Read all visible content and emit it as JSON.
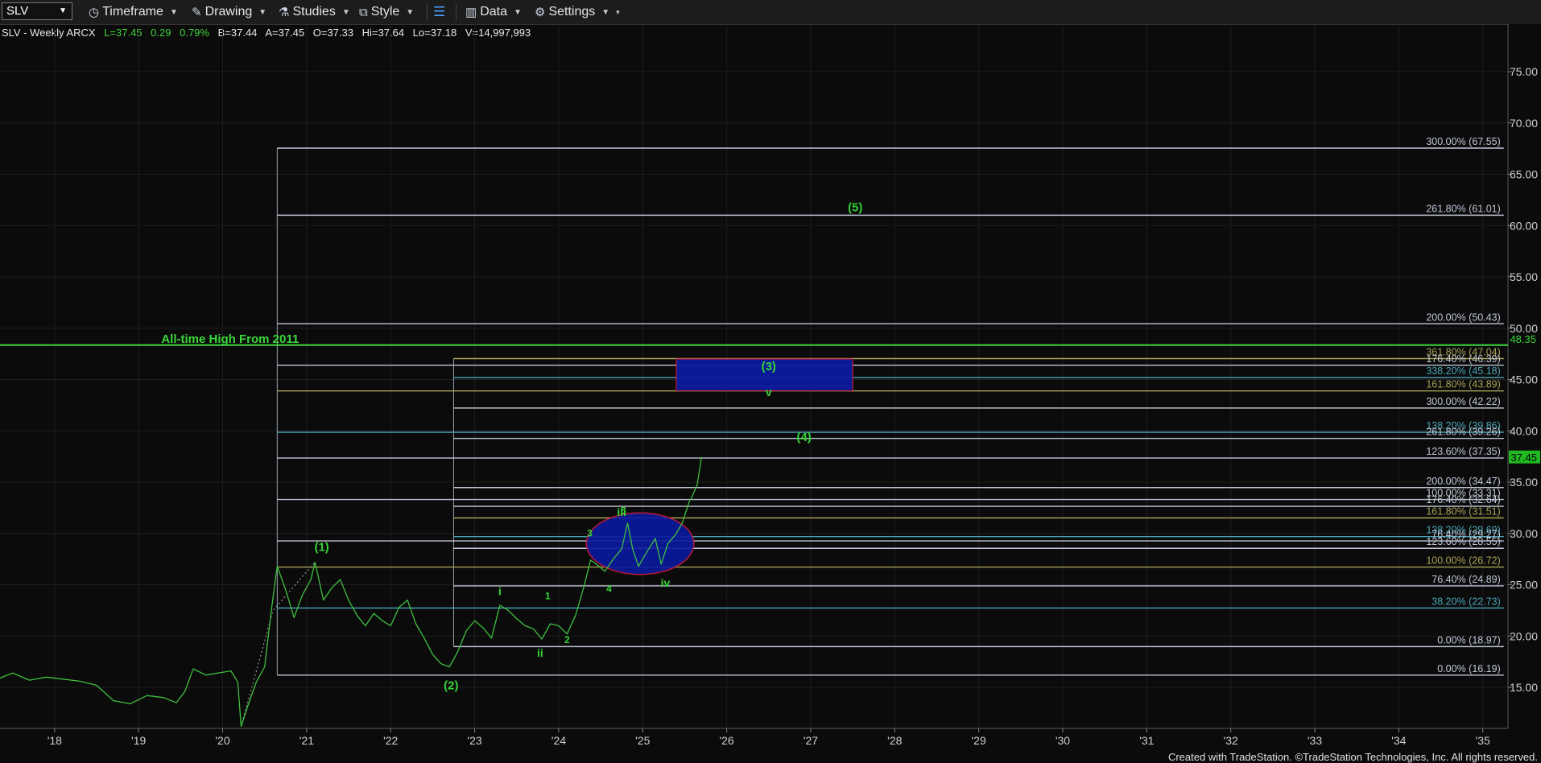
{
  "toolbar": {
    "symbol": "SLV",
    "timeframe": "Timeframe",
    "drawing": "Drawing",
    "studies": "Studies",
    "style": "Style",
    "data": "Data",
    "settings": "Settings"
  },
  "quote": {
    "title": "SLV - Weekly ARCX",
    "last": "L=37.45",
    "change": "0.29",
    "pct": "0.79%",
    "bid": "B=37.44",
    "ask": "A=37.45",
    "open": "O=37.33",
    "high": "Hi=37.64",
    "low": "Lo=37.18",
    "volume": "V=14,997,993"
  },
  "footer": "Created with TradeStation. ©TradeStation Technologies, Inc. All rights reserved.",
  "colors": {
    "price": "#3fbf3f",
    "green_label": "#36d536",
    "ath": "#39d839",
    "fib_white": "#c0c6d6",
    "fib_teal": "#4aa6b8",
    "fib_olive": "#a7a257",
    "box_fill": "#0a1a9e",
    "box_border": "#d11a3a"
  },
  "chart_data": {
    "type": "line",
    "title": "SLV - Weekly ARCX",
    "xlabel": "",
    "ylabel": "",
    "ylim": [
      11,
      79
    ],
    "x_range": [
      2017.35,
      2035.3
    ],
    "y_ticks": [
      15,
      20,
      25,
      30,
      35,
      40,
      45,
      50,
      55,
      60,
      65,
      70,
      75
    ],
    "y_tick_labels": [
      "15.00",
      "20.00",
      "25.00",
      "30.00",
      "35.00",
      "40.00",
      "45.00",
      "50.00",
      "55.00",
      "60.00",
      "65.00",
      "70.00",
      "75.00"
    ],
    "x_ticks": [
      2018,
      2019,
      2020,
      2021,
      2022,
      2023,
      2024,
      2025,
      2026,
      2027,
      2028,
      2029,
      2030,
      2031,
      2032,
      2033,
      2034,
      2035
    ],
    "x_tick_labels": [
      "'18",
      "'19",
      "'20",
      "'21",
      "'22",
      "'23",
      "'24",
      "'25",
      "'26",
      "'27",
      "'28",
      "'29",
      "'30",
      "'31",
      "'32",
      "'33",
      "'34",
      "'35"
    ],
    "grid": true,
    "last_price": 37.45,
    "last_price_label": "37.45",
    "ath": {
      "value": 48.35,
      "label": "48.35",
      "text": "All-time High From 2011"
    },
    "series": [
      {
        "name": "SLV",
        "points": [
          [
            2017.35,
            15.9
          ],
          [
            2017.5,
            16.4
          ],
          [
            2017.7,
            15.7
          ],
          [
            2017.9,
            16.0
          ],
          [
            2018.1,
            15.8
          ],
          [
            2018.3,
            15.6
          ],
          [
            2018.5,
            15.2
          ],
          [
            2018.7,
            13.7
          ],
          [
            2018.9,
            13.4
          ],
          [
            2019.1,
            14.2
          ],
          [
            2019.3,
            14.0
          ],
          [
            2019.45,
            13.5
          ],
          [
            2019.55,
            14.6
          ],
          [
            2019.65,
            16.8
          ],
          [
            2019.8,
            16.2
          ],
          [
            2019.95,
            16.4
          ],
          [
            2020.1,
            16.6
          ],
          [
            2020.18,
            15.5
          ],
          [
            2020.22,
            11.2
          ],
          [
            2020.3,
            13.2
          ],
          [
            2020.4,
            15.5
          ],
          [
            2020.5,
            17.0
          ],
          [
            2020.58,
            22.5
          ],
          [
            2020.65,
            26.8
          ],
          [
            2020.75,
            24.5
          ],
          [
            2020.85,
            21.8
          ],
          [
            2020.95,
            24.0
          ],
          [
            2021.05,
            25.5
          ],
          [
            2021.1,
            27.2
          ],
          [
            2021.2,
            23.5
          ],
          [
            2021.3,
            24.7
          ],
          [
            2021.4,
            25.5
          ],
          [
            2021.5,
            23.5
          ],
          [
            2021.6,
            22.0
          ],
          [
            2021.7,
            21.0
          ],
          [
            2021.8,
            22.2
          ],
          [
            2021.9,
            21.5
          ],
          [
            2022.0,
            21.0
          ],
          [
            2022.1,
            22.8
          ],
          [
            2022.2,
            23.5
          ],
          [
            2022.3,
            21.2
          ],
          [
            2022.4,
            19.8
          ],
          [
            2022.5,
            18.2
          ],
          [
            2022.6,
            17.3
          ],
          [
            2022.7,
            17.0
          ],
          [
            2022.8,
            18.5
          ],
          [
            2022.9,
            20.5
          ],
          [
            2023.0,
            21.5
          ],
          [
            2023.1,
            20.8
          ],
          [
            2023.2,
            19.8
          ],
          [
            2023.3,
            23.0
          ],
          [
            2023.4,
            22.5
          ],
          [
            2023.5,
            21.7
          ],
          [
            2023.6,
            21.0
          ],
          [
            2023.7,
            20.7
          ],
          [
            2023.8,
            19.7
          ],
          [
            2023.9,
            21.2
          ],
          [
            2024.0,
            21.0
          ],
          [
            2024.1,
            20.2
          ],
          [
            2024.2,
            22.0
          ],
          [
            2024.3,
            24.8
          ],
          [
            2024.38,
            27.4
          ],
          [
            2024.45,
            27.0
          ],
          [
            2024.55,
            26.3
          ],
          [
            2024.65,
            27.5
          ],
          [
            2024.75,
            28.5
          ],
          [
            2024.82,
            31.0
          ],
          [
            2024.88,
            28.5
          ],
          [
            2024.95,
            26.8
          ],
          [
            2025.05,
            28.2
          ],
          [
            2025.15,
            29.5
          ],
          [
            2025.22,
            27.0
          ],
          [
            2025.3,
            29.0
          ],
          [
            2025.4,
            30.0
          ],
          [
            2025.47,
            31.0
          ],
          [
            2025.55,
            33.0
          ],
          [
            2025.6,
            33.8
          ],
          [
            2025.65,
            34.8
          ],
          [
            2025.7,
            37.45
          ]
        ]
      }
    ],
    "fib_levels": [
      {
        "label": "300.00% (67.55)",
        "value": 67.55,
        "x_start": 2020.65,
        "color": "white"
      },
      {
        "label": "261.80% (61.01)",
        "value": 61.01,
        "x_start": 2020.65,
        "color": "white"
      },
      {
        "label": "200.00% (50.43)",
        "value": 50.43,
        "x_start": 2020.65,
        "color": "white"
      },
      {
        "label": "361.80% (47.04)",
        "value": 47.04,
        "x_start": 2022.75,
        "color": "olive"
      },
      {
        "label": "176.40% (46.39)",
        "value": 46.39,
        "x_start": 2020.65,
        "color": "white"
      },
      {
        "label": "338.20% (45.18)",
        "value": 45.18,
        "x_start": 2022.75,
        "color": "teal"
      },
      {
        "label": "161.80% (43.89)",
        "value": 43.89,
        "x_start": 2020.65,
        "color": "olive"
      },
      {
        "label": "300.00% (42.22)",
        "value": 42.22,
        "x_start": 2022.75,
        "color": "white"
      },
      {
        "label": "138.20% (39.86)",
        "value": 39.86,
        "x_start": 2020.65,
        "color": "teal"
      },
      {
        "label": "261.80% (39.26)",
        "value": 39.26,
        "x_start": 2022.75,
        "color": "white"
      },
      {
        "label": "123.60% (37.35)",
        "value": 37.35,
        "x_start": 2020.65,
        "color": "white"
      },
      {
        "label": "200.00% (34.47)",
        "value": 34.47,
        "x_start": 2022.75,
        "color": "white"
      },
      {
        "label": "100.00% (33.31)",
        "value": 33.31,
        "x_start": 2020.65,
        "color": "white"
      },
      {
        "label": "176.40% (32.64)",
        "value": 32.64,
        "x_start": 2022.75,
        "color": "white"
      },
      {
        "label": "161.80% (31.51)",
        "value": 31.51,
        "x_start": 2022.75,
        "color": "olive"
      },
      {
        "label": "138.20% (29.69)",
        "value": 29.69,
        "x_start": 2022.75,
        "color": "teal"
      },
      {
        "label": "76.40% (29.27)",
        "value": 29.27,
        "x_start": 2020.65,
        "color": "white"
      },
      {
        "label": "123.60% (28.55)",
        "value": 28.55,
        "x_start": 2022.75,
        "color": "white"
      },
      {
        "label": "100.00% (26.72)",
        "value": 26.72,
        "x_start": 2020.65,
        "color": "olive"
      },
      {
        "label": "76.40% (24.89)",
        "value": 24.89,
        "x_start": 2022.75,
        "color": "white"
      },
      {
        "label": "38.20% (22.73)",
        "value": 22.73,
        "x_start": 2020.65,
        "color": "teal"
      },
      {
        "label": "0.00% (18.97)",
        "value": 18.97,
        "x_start": 2022.75,
        "color": "white"
      },
      {
        "label": "0.00% (16.19)",
        "value": 16.19,
        "x_start": 2020.65,
        "color": "white"
      }
    ],
    "fib_x_end": 2035.25,
    "target_box": {
      "x0": 2025.4,
      "x1": 2027.5,
      "y0": 43.9,
      "y1": 47.0
    },
    "ellipse": {
      "cx": 2024.97,
      "cy": 29.0,
      "rx": 0.64,
      "ry": 3.0
    },
    "wave_labels": [
      {
        "text": "(1)",
        "x": 2021.18,
        "y": 28.3,
        "size": "big"
      },
      {
        "text": "(2)",
        "x": 2022.72,
        "y": 14.8,
        "size": "big"
      },
      {
        "text": "(3)",
        "x": 2026.5,
        "y": 45.9,
        "size": "big"
      },
      {
        "text": "(4)",
        "x": 2026.92,
        "y": 39.0,
        "size": "big"
      },
      {
        "text": "(5)",
        "x": 2027.53,
        "y": 61.4,
        "size": "big"
      },
      {
        "text": "i",
        "x": 2023.3,
        "y": 24.0,
        "size": "mid"
      },
      {
        "text": "ii",
        "x": 2023.78,
        "y": 18.0,
        "size": "mid"
      },
      {
        "text": "iii",
        "x": 2024.75,
        "y": 31.7,
        "size": "mid"
      },
      {
        "text": "iv",
        "x": 2025.27,
        "y": 24.8,
        "size": "mid"
      },
      {
        "text": "v",
        "x": 2026.5,
        "y": 43.4,
        "size": "mid"
      },
      {
        "text": "1",
        "x": 2023.87,
        "y": 23.6,
        "size": "small"
      },
      {
        "text": "2",
        "x": 2024.1,
        "y": 19.3,
        "size": "small"
      },
      {
        "text": "3",
        "x": 2024.37,
        "y": 29.7,
        "size": "small"
      },
      {
        "text": "4",
        "x": 2024.6,
        "y": 24.3,
        "size": "small"
      },
      {
        "text": "5",
        "x": 2024.77,
        "y": 31.9,
        "size": "small"
      }
    ]
  }
}
